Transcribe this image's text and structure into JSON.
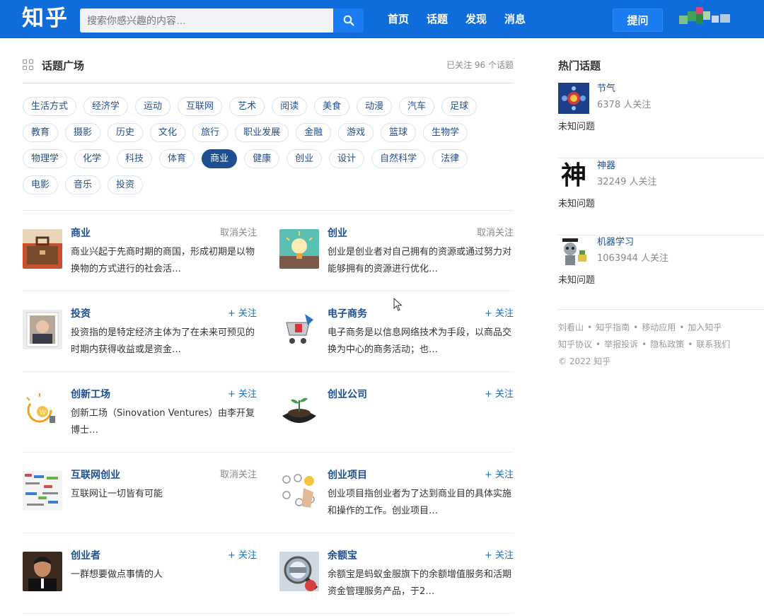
{
  "header": {
    "logo": "知乎",
    "search_placeholder": "搜索你感兴趣的内容…",
    "nav": [
      "首页",
      "话题",
      "发现",
      "消息"
    ],
    "ask_label": "提问"
  },
  "section": {
    "title": "话题广场",
    "follow_count": "已关注 96 个话题"
  },
  "tags": [
    [
      "生活方式",
      "经济学",
      "运动",
      "互联网",
      "艺术",
      "阅读",
      "美食",
      "动漫",
      "汽车",
      "足球"
    ],
    [
      "教育",
      "摄影",
      "历史",
      "文化",
      "旅行",
      "职业发展",
      "金融",
      "游戏",
      "篮球",
      "生物学"
    ],
    [
      "物理学",
      "化学",
      "科技",
      "体育",
      "商业",
      "健康",
      "创业",
      "设计",
      "自然科学",
      "法律"
    ],
    [
      "电影",
      "音乐",
      "投资"
    ]
  ],
  "active_tag": "商业",
  "topics": [
    [
      {
        "name": "商业",
        "follow": "取消关注",
        "desc": "商业兴起于先商时期的商国，形成初期是以物换物的方式进行的社会活…"
      },
      {
        "name": "创业",
        "follow": "取消关注",
        "desc": "创业是创业者对自己拥有的资源或通过努力对能够拥有的资源进行优化…"
      }
    ],
    [
      {
        "name": "投资",
        "follow": "+ 关注",
        "desc": "投资指的是特定经济主体为了在未来可预见的时期内获得收益或是资金…"
      },
      {
        "name": "电子商务",
        "follow": "+ 关注",
        "desc": "电子商务是以信息网络技术为手段，以商品交换为中心的商务活动；也…"
      }
    ],
    [
      {
        "name": "创新工场",
        "follow": "+ 关注",
        "desc": "创新工场（Sinovation Ventures）由李开复博士…"
      },
      {
        "name": "创业公司",
        "follow": "+ 关注",
        "desc": ""
      }
    ],
    [
      {
        "name": "互联网创业",
        "follow": "取消关注",
        "desc": "互联网让一切皆有可能"
      },
      {
        "name": "创业项目",
        "follow": "+ 关注",
        "desc": "创业项目指创业者为了达到商业目的具体实施和操作的工作。创业项目…"
      }
    ],
    [
      {
        "name": "创业者",
        "follow": "+ 关注",
        "desc": "一群想要做点事情的人"
      },
      {
        "name": "余额宝",
        "follow": "+ 关注",
        "desc": "余额宝是蚂蚁金服旗下的余额增值服务和活期资金管理服务产品，于2…"
      }
    ]
  ],
  "sidebar": {
    "title": "热门话题",
    "hot": [
      {
        "name": "节气",
        "count": "6378 人关注",
        "question": "未知问题"
      },
      {
        "name": "神器",
        "count": "32249 人关注",
        "question": "未知问题",
        "glyph": "神"
      },
      {
        "name": "机器学习",
        "count": "1063944 人关注",
        "question": "未知问题"
      }
    ],
    "footer_line1": [
      "刘看山",
      "知乎指南",
      "移动应用",
      "加入知乎"
    ],
    "footer_line2": [
      "知乎协议",
      "举报投诉",
      "隐私政策",
      "联系我们"
    ],
    "copyright": "© 2022 知乎"
  }
}
